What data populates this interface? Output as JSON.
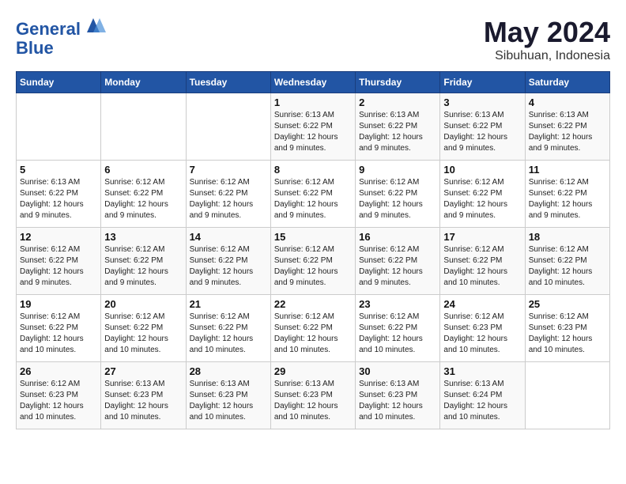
{
  "logo": {
    "line1": "General",
    "line2": "Blue"
  },
  "title": "May 2024",
  "subtitle": "Sibuhuan, Indonesia",
  "header": {
    "days": [
      "Sunday",
      "Monday",
      "Tuesday",
      "Wednesday",
      "Thursday",
      "Friday",
      "Saturday"
    ]
  },
  "weeks": [
    [
      {
        "day": "",
        "info": ""
      },
      {
        "day": "",
        "info": ""
      },
      {
        "day": "",
        "info": ""
      },
      {
        "day": "1",
        "info": "Sunrise: 6:13 AM\nSunset: 6:22 PM\nDaylight: 12 hours and 9 minutes."
      },
      {
        "day": "2",
        "info": "Sunrise: 6:13 AM\nSunset: 6:22 PM\nDaylight: 12 hours and 9 minutes."
      },
      {
        "day": "3",
        "info": "Sunrise: 6:13 AM\nSunset: 6:22 PM\nDaylight: 12 hours and 9 minutes."
      },
      {
        "day": "4",
        "info": "Sunrise: 6:13 AM\nSunset: 6:22 PM\nDaylight: 12 hours and 9 minutes."
      }
    ],
    [
      {
        "day": "5",
        "info": "Sunrise: 6:13 AM\nSunset: 6:22 PM\nDaylight: 12 hours and 9 minutes."
      },
      {
        "day": "6",
        "info": "Sunrise: 6:12 AM\nSunset: 6:22 PM\nDaylight: 12 hours and 9 minutes."
      },
      {
        "day": "7",
        "info": "Sunrise: 6:12 AM\nSunset: 6:22 PM\nDaylight: 12 hours and 9 minutes."
      },
      {
        "day": "8",
        "info": "Sunrise: 6:12 AM\nSunset: 6:22 PM\nDaylight: 12 hours and 9 minutes."
      },
      {
        "day": "9",
        "info": "Sunrise: 6:12 AM\nSunset: 6:22 PM\nDaylight: 12 hours and 9 minutes."
      },
      {
        "day": "10",
        "info": "Sunrise: 6:12 AM\nSunset: 6:22 PM\nDaylight: 12 hours and 9 minutes."
      },
      {
        "day": "11",
        "info": "Sunrise: 6:12 AM\nSunset: 6:22 PM\nDaylight: 12 hours and 9 minutes."
      }
    ],
    [
      {
        "day": "12",
        "info": "Sunrise: 6:12 AM\nSunset: 6:22 PM\nDaylight: 12 hours and 9 minutes."
      },
      {
        "day": "13",
        "info": "Sunrise: 6:12 AM\nSunset: 6:22 PM\nDaylight: 12 hours and 9 minutes."
      },
      {
        "day": "14",
        "info": "Sunrise: 6:12 AM\nSunset: 6:22 PM\nDaylight: 12 hours and 9 minutes."
      },
      {
        "day": "15",
        "info": "Sunrise: 6:12 AM\nSunset: 6:22 PM\nDaylight: 12 hours and 9 minutes."
      },
      {
        "day": "16",
        "info": "Sunrise: 6:12 AM\nSunset: 6:22 PM\nDaylight: 12 hours and 9 minutes."
      },
      {
        "day": "17",
        "info": "Sunrise: 6:12 AM\nSunset: 6:22 PM\nDaylight: 12 hours and 10 minutes."
      },
      {
        "day": "18",
        "info": "Sunrise: 6:12 AM\nSunset: 6:22 PM\nDaylight: 12 hours and 10 minutes."
      }
    ],
    [
      {
        "day": "19",
        "info": "Sunrise: 6:12 AM\nSunset: 6:22 PM\nDaylight: 12 hours and 10 minutes."
      },
      {
        "day": "20",
        "info": "Sunrise: 6:12 AM\nSunset: 6:22 PM\nDaylight: 12 hours and 10 minutes."
      },
      {
        "day": "21",
        "info": "Sunrise: 6:12 AM\nSunset: 6:22 PM\nDaylight: 12 hours and 10 minutes."
      },
      {
        "day": "22",
        "info": "Sunrise: 6:12 AM\nSunset: 6:22 PM\nDaylight: 12 hours and 10 minutes."
      },
      {
        "day": "23",
        "info": "Sunrise: 6:12 AM\nSunset: 6:22 PM\nDaylight: 12 hours and 10 minutes."
      },
      {
        "day": "24",
        "info": "Sunrise: 6:12 AM\nSunset: 6:23 PM\nDaylight: 12 hours and 10 minutes."
      },
      {
        "day": "25",
        "info": "Sunrise: 6:12 AM\nSunset: 6:23 PM\nDaylight: 12 hours and 10 minutes."
      }
    ],
    [
      {
        "day": "26",
        "info": "Sunrise: 6:12 AM\nSunset: 6:23 PM\nDaylight: 12 hours and 10 minutes."
      },
      {
        "day": "27",
        "info": "Sunrise: 6:13 AM\nSunset: 6:23 PM\nDaylight: 12 hours and 10 minutes."
      },
      {
        "day": "28",
        "info": "Sunrise: 6:13 AM\nSunset: 6:23 PM\nDaylight: 12 hours and 10 minutes."
      },
      {
        "day": "29",
        "info": "Sunrise: 6:13 AM\nSunset: 6:23 PM\nDaylight: 12 hours and 10 minutes."
      },
      {
        "day": "30",
        "info": "Sunrise: 6:13 AM\nSunset: 6:23 PM\nDaylight: 12 hours and 10 minutes."
      },
      {
        "day": "31",
        "info": "Sunrise: 6:13 AM\nSunset: 6:24 PM\nDaylight: 12 hours and 10 minutes."
      },
      {
        "day": "",
        "info": ""
      }
    ]
  ]
}
